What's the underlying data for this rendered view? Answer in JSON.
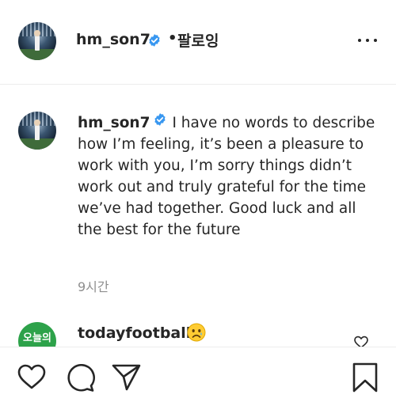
{
  "header": {
    "username": "hm_son7",
    "follow_label": "팔로잉",
    "dot": "•"
  },
  "caption": {
    "username": "hm_son7",
    "text": "I have no words to describe how I’m feeling, it’s been a pleasure to work with you, I’m sorry things didn’t work out and truly grateful for the time we’ve had together. Good luck and all the best for the future",
    "time": "9시간"
  },
  "comment": {
    "username": "todayfootball",
    "avatar_text": "오늘의",
    "emoji": "crying-face"
  },
  "icons": {
    "verified": "verified-badge-icon",
    "more": "more-options-icon",
    "like": "heart-icon",
    "comment": "comment-icon",
    "share": "paper-plane-icon",
    "save": "bookmark-icon"
  },
  "colors": {
    "verified": "#3897f0",
    "text": "#262626",
    "secondary": "#8e8e8e",
    "comment_avatar": "#2da24a"
  }
}
